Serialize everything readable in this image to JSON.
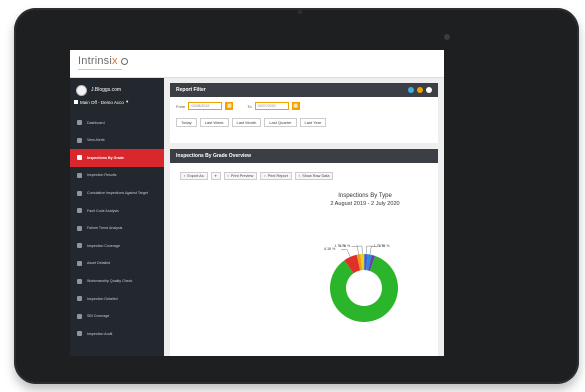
{
  "colors": {
    "sidebar_bg": "#23272e",
    "active_nav": "#d8282d",
    "accent_orange": "#f0a100",
    "panel_header": "#3b3f45",
    "dot_blue": "#3ab0e0",
    "dot_amber": "#f0a100",
    "dot_white": "#ffffff",
    "slice_green": "#2bb52b",
    "slice_red": "#e0302a",
    "slice_orange": "#f09a1a",
    "slice_yellow": "#e8d21c",
    "slice_blue": "#3f62c8",
    "slice_purple": "#6a3fb0"
  },
  "app": {
    "logo_text": "Intrinsi",
    "logo_accent": "x"
  },
  "user": {
    "name": "J.Bloggs.com",
    "office": "Main Off - Demo Acco"
  },
  "nav": [
    {
      "label": "Dashboard",
      "icon": "home-icon",
      "active": false
    },
    {
      "label": "View Alerts",
      "icon": "warning-icon",
      "active": false
    },
    {
      "label": "Inspections By Grade",
      "icon": "chart-icon",
      "active": true
    },
    {
      "label": "Inspection Results",
      "icon": "list-icon",
      "active": false
    },
    {
      "label": "Cumulative Inspections Against Target",
      "icon": "target-icon",
      "active": false
    },
    {
      "label": "Fault Code Analysis",
      "icon": "code-icon",
      "active": false
    },
    {
      "label": "Failure Trend Analysis",
      "icon": "trend-icon",
      "active": false
    },
    {
      "label": "Inspection Coverage",
      "icon": "grid-icon",
      "active": false
    },
    {
      "label": "Asset Detailed",
      "icon": "asset-icon",
      "active": false
    },
    {
      "label": "Workmanship Quality Check",
      "icon": "check-icon",
      "active": false
    },
    {
      "label": "Inspection Detailed",
      "icon": "detail-icon",
      "active": false
    },
    {
      "label": "SBI Coverage",
      "icon": "coverage-icon",
      "active": false
    },
    {
      "label": "Inspection Audit",
      "icon": "audit-icon",
      "active": false
    }
  ],
  "report_filter": {
    "title": "Report Filter",
    "from_label": "From",
    "from_value": "02/08/2019",
    "to_label": "To",
    "to_value": "02/07/2020",
    "quick_ranges": [
      "Today",
      "Last Week",
      "Last Month",
      "Last Quarter",
      "Last Year"
    ]
  },
  "overview": {
    "title": "Inspections By Grade Overview",
    "toolbar": [
      {
        "label": "Export As",
        "icon": "export-icon"
      },
      {
        "label": "",
        "icon": "chevron-down-icon"
      },
      {
        "label": "Print Preview",
        "icon": "search-icon"
      },
      {
        "label": "Print Report",
        "icon": "printer-icon"
      },
      {
        "label": "Show Raw Data",
        "icon": "table-icon"
      }
    ]
  },
  "chart_data": {
    "type": "pie",
    "title": "Inspections By Type",
    "subtitle": "2 August 2019 - 2 July 2020",
    "slices": [
      {
        "value": 84.94,
        "label": "",
        "color": "#2bb52b"
      },
      {
        "value": 6.38,
        "label": "6.38 %",
        "color": "#e0302a"
      },
      {
        "value": 1.76,
        "label": "1.76 %",
        "color": "#f09a1a"
      },
      {
        "value": 1.76,
        "label": "1.76 %",
        "color": "#e8d21c"
      },
      {
        "value": 1.76,
        "label": "1.76 %",
        "color": "#3f62c8"
      },
      {
        "value": 1.76,
        "label": "1.76 %",
        "color": "#2b8ad8"
      },
      {
        "value": 1.64,
        "label": "",
        "color": "#6a3fb0"
      }
    ]
  }
}
